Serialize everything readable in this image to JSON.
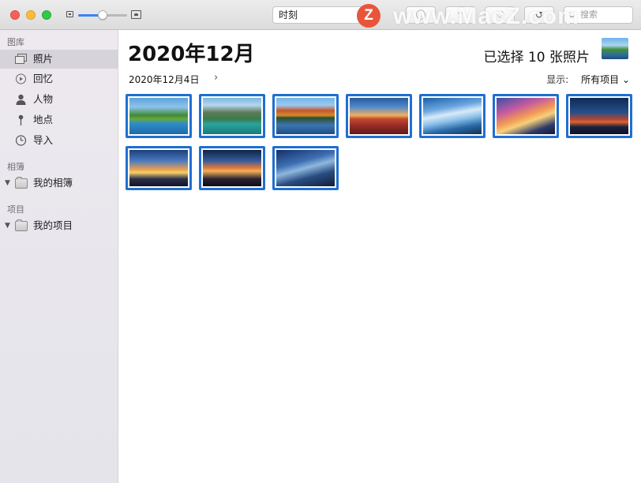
{
  "window": {
    "traffic_lights": [
      "close",
      "minimize",
      "zoom"
    ]
  },
  "toolbar": {
    "zoom_level": 0.5,
    "view_select_value": "时刻",
    "buttons": [
      {
        "name": "info-button",
        "icon": "info-icon",
        "glyph": "ⓘ"
      },
      {
        "name": "share-button",
        "icon": "share-icon",
        "glyph": "⇧"
      },
      {
        "name": "favorite-button",
        "icon": "heart-icon",
        "glyph": "♡"
      },
      {
        "name": "rotate-button",
        "icon": "rotate-icon",
        "glyph": "↺"
      }
    ],
    "search_placeholder": "搜索"
  },
  "watermark": {
    "logo_letter": "Z",
    "text": "www.MacZ.com"
  },
  "sidebar": {
    "library_header": "图库",
    "library_items": [
      {
        "label": "照片",
        "icon": "photos-icon",
        "selected": true
      },
      {
        "label": "回忆",
        "icon": "memories-icon",
        "selected": false
      },
      {
        "label": "人物",
        "icon": "people-icon",
        "selected": false
      },
      {
        "label": "地点",
        "icon": "places-icon",
        "selected": false
      },
      {
        "label": "导入",
        "icon": "imports-icon",
        "selected": false
      }
    ],
    "albums_header": "相簿",
    "albums_item": "我的相簿",
    "projects_header": "项目",
    "projects_item": "我的项目"
  },
  "main": {
    "title": "2020年12月",
    "selection_count": "已选择 10 张照片",
    "date_label": "2020年12月4日",
    "date_chevron": "›",
    "filter_label": "显示:",
    "filter_value": "所有项目",
    "photos": [
      {
        "subject": "tree-lake",
        "selected": true
      },
      {
        "subject": "mountain-lake",
        "selected": true
      },
      {
        "subject": "autumn-forest-lake",
        "selected": true
      },
      {
        "subject": "sunset-field",
        "selected": true
      },
      {
        "subject": "sky-streaks-coast",
        "selected": true
      },
      {
        "subject": "colorful-sky-tree",
        "selected": true
      },
      {
        "subject": "night-sky-fire",
        "selected": true
      },
      {
        "subject": "sunset-lake-island",
        "selected": true
      },
      {
        "subject": "sunset-star-trails",
        "selected": true
      },
      {
        "subject": "sky-trails-dusk",
        "selected": true
      }
    ]
  },
  "colors": {
    "selection_border": "#1f6fd1",
    "sidebar_selected": "#d6d3da",
    "slider_accent": "#3a82f7"
  }
}
